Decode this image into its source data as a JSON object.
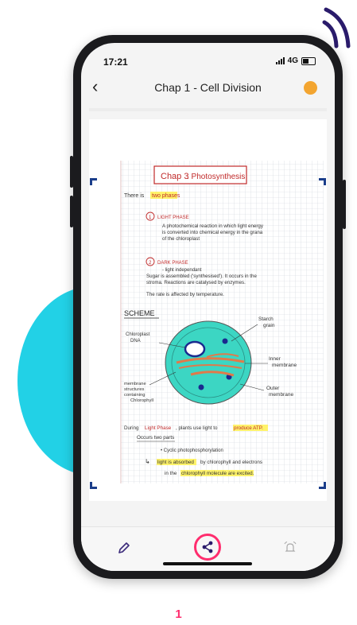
{
  "status": {
    "time": "17:21",
    "network": "4G"
  },
  "header": {
    "title": "Chap 1 - Cell Division"
  },
  "note": {
    "heading_chap": "Chap 3",
    "heading_topic": ": Photosynthesis",
    "intro_a": "There is",
    "intro_b": "two phases",
    "phase1_num": "1",
    "phase1_title": "LIGHT PHASE",
    "phase1_line1": "A photochemical reaction in which light energy",
    "phase1_line2": "is converted into chemical energy in the grana",
    "phase1_line3": "of the chloroplast",
    "phase2_num": "2",
    "phase2_title": "DARK PHASE",
    "phase2_line1": "- light independant",
    "phase2_line2": "Sugar is assembled ('synthesised'). It occurs in the",
    "phase2_line3": "stroma. Reactions are catalysed by enzymes.",
    "phase2_line4": "The rate is affected by temperature.",
    "scheme": "SCHEME",
    "lbl_starch1": "Starch",
    "lbl_starch2": "grain",
    "lbl_chloro1": "Chloroplast",
    "lbl_chloro2": "DNA",
    "lbl_inner1": "Inner",
    "lbl_inner2": "membrane",
    "lbl_mem1": "membrane",
    "lbl_mem2": "structures",
    "lbl_mem3": "containing",
    "lbl_mem4": "Chlorophyll",
    "lbl_outer1": "Outer",
    "lbl_outer2": "membrane",
    "during_a": "During",
    "during_b": "Light Phase",
    "during_c": ", plants use light to",
    "during_d": "produce ATP.",
    "occurs": "Occurs two parts",
    "bullet": "• Cyclic photophosphorylation",
    "arrow_a": "light is absorbed",
    "arrow_b": "by chlorophyll and electrons",
    "arrow_c": "in the",
    "arrow_d": "chlorophyll molecule are excited."
  },
  "toolbar": {
    "edit_icon": "pencil-icon",
    "share_icon": "share-icon",
    "alarm_icon": "alarm-icon"
  },
  "page_number": "1",
  "colors": {
    "accent": "#ff2d6e",
    "cyan": "#22d1e6",
    "orange": "#f3a530",
    "highlight": "#fff36b",
    "chloroplast": "#39d9c2",
    "membrane": "#b40e2a"
  }
}
